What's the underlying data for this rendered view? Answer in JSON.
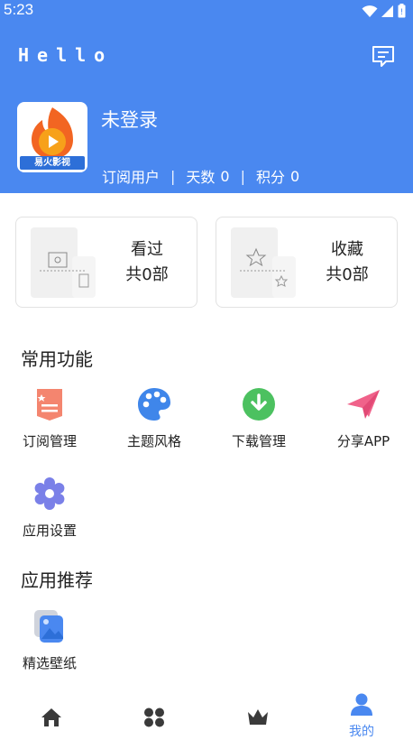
{
  "status_bar": {
    "time": "5:23"
  },
  "header": {
    "app_title": "Hello",
    "avatar_logo_text": "易火影视",
    "login_status": "未登录",
    "stats": {
      "subscription_label": "订阅用户",
      "days_label": "天数",
      "days_value": "0",
      "points_label": "积分",
      "points_value": "0"
    }
  },
  "cards": {
    "watched": {
      "title": "看过",
      "count": "共0部"
    },
    "favorites": {
      "title": "收藏",
      "count": "共0部"
    }
  },
  "common_functions": {
    "title": "常用功能",
    "items": [
      {
        "label": "订阅管理",
        "icon": "subscription-icon",
        "color": "#f4856f"
      },
      {
        "label": "主题风格",
        "icon": "palette-icon",
        "color": "#3f86ea"
      },
      {
        "label": "下载管理",
        "icon": "download-icon",
        "color": "#4cc160"
      },
      {
        "label": "分享APP",
        "icon": "paper-plane-icon",
        "color": "#f0628a"
      },
      {
        "label": "应用设置",
        "icon": "gear-icon",
        "color": "#7a80e8"
      }
    ]
  },
  "app_recommend": {
    "title": "应用推荐",
    "items": [
      {
        "label": "精选壁纸",
        "icon": "wallpaper-icon",
        "color": "#4a88f0"
      }
    ]
  },
  "bottom_nav": {
    "items": [
      {
        "icon": "home-icon",
        "label": ""
      },
      {
        "icon": "grid-icon",
        "label": ""
      },
      {
        "icon": "crown-icon",
        "label": ""
      },
      {
        "icon": "user-icon",
        "label": "我的",
        "active": true
      }
    ]
  },
  "colors": {
    "primary": "#4a88f0",
    "inactive_nav": "#3a3a3a"
  }
}
